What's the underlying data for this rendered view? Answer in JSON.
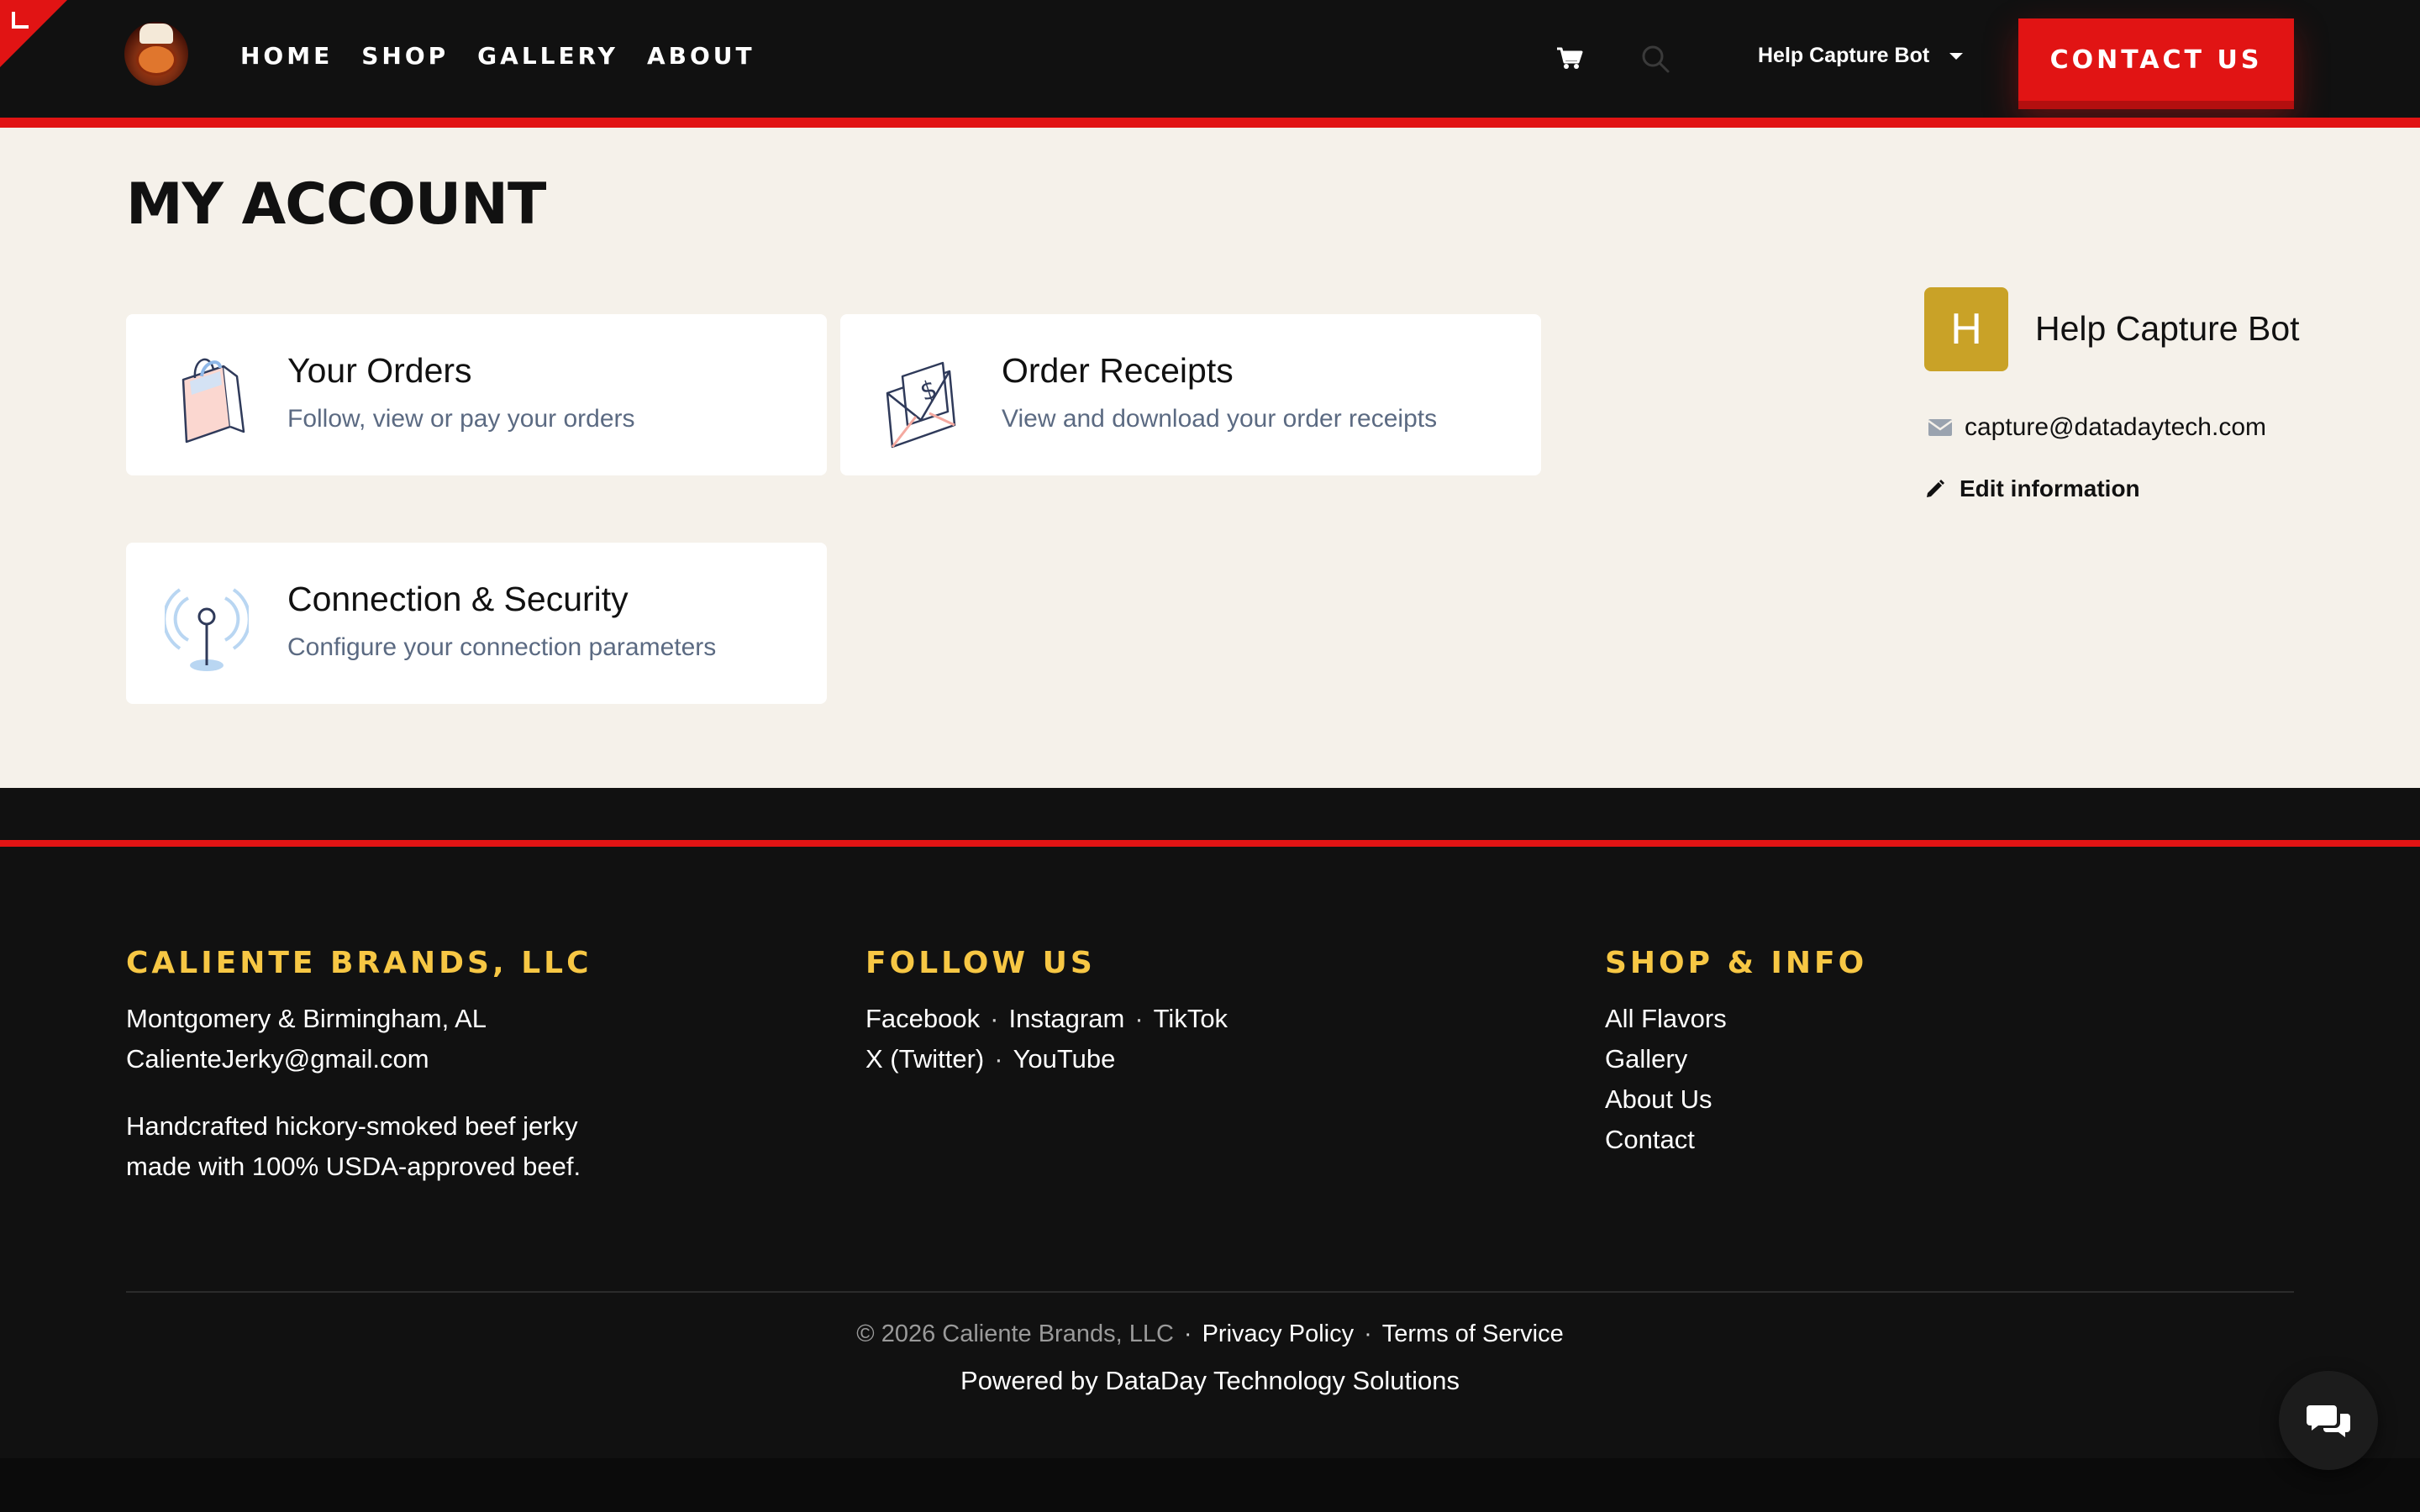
{
  "header": {
    "nav": [
      {
        "label": "HOME"
      },
      {
        "label": "SHOP"
      },
      {
        "label": "GALLERY"
      },
      {
        "label": "ABOUT"
      }
    ],
    "user_menu_label": "Help Capture Bot",
    "contact_label": "CONTACT US"
  },
  "main": {
    "title": "MY ACCOUNT",
    "cards": [
      {
        "title": "Your Orders",
        "desc": "Follow, view or pay your orders",
        "icon": "shopping-bag-icon"
      },
      {
        "title": "Order Receipts",
        "desc": "View and download your order receipts",
        "icon": "receipt-envelope-icon"
      },
      {
        "title": "Connection & Security",
        "desc": "Configure your connection parameters",
        "icon": "antenna-icon"
      }
    ],
    "profile": {
      "initial": "H",
      "name": "Help Capture Bot",
      "email": "capture@datadaytech.com",
      "edit_label": "Edit information"
    }
  },
  "footer": {
    "company": {
      "heading": "CALIENTE BRANDS, LLC",
      "location": "Montgomery & Birmingham, AL",
      "email": "CalienteJerky@gmail.com",
      "tagline_1": "Handcrafted hickory-smoked beef jerky",
      "tagline_2": "made with 100% USDA-approved beef."
    },
    "follow": {
      "heading": "FOLLOW US",
      "links": [
        "Facebook",
        "Instagram",
        "TikTok",
        "X (Twitter)",
        "YouTube"
      ]
    },
    "shop": {
      "heading": "SHOP & INFO",
      "links": [
        "All Flavors",
        "Gallery",
        "About Us",
        "Contact"
      ]
    },
    "copyright": "© 2026 Caliente Brands, LLC",
    "privacy": "Privacy Policy",
    "terms": "Terms of Service",
    "separator": "·",
    "powered": "Powered by DataDay Technology Solutions"
  },
  "colors": {
    "accent_red": "#e11414",
    "footer_heading_gold": "#f7c744",
    "avatar_gold": "#c9a227",
    "page_bg": "#f5f1ea"
  }
}
